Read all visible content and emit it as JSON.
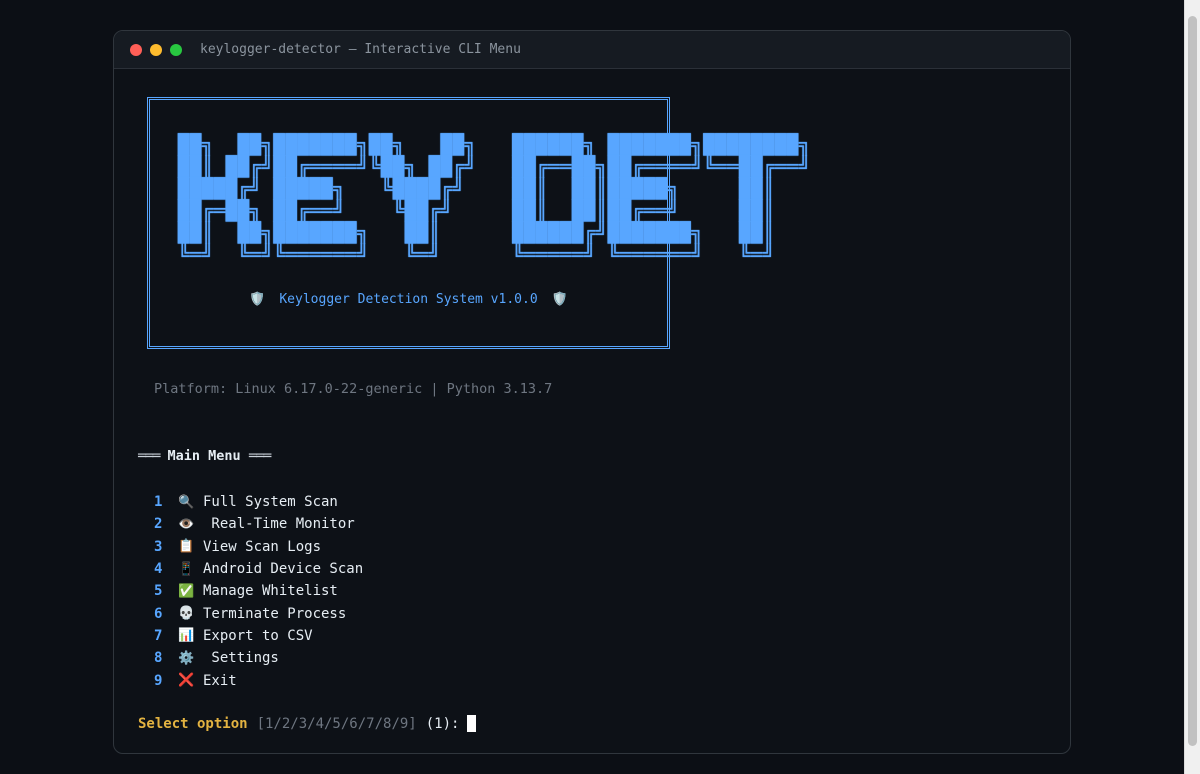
{
  "window": {
    "title": "keylogger-detector — Interactive CLI Menu"
  },
  "banner": {
    "ascii_art": "██╗  ██╗███████╗██╗   ██╗   ██████╗ ███████╗████████╗\n██║ ██╔╝██╔════╝╚██╗ ██╔╝   ██╔══██╗██╔════╝╚══██╔══╝\n█████╔╝ █████╗   ╚████╔╝    ██║  ██║█████╗     ██║   \n██╔═██╗ ██╔══╝    ╚██╔╝     ██║  ██║██╔══╝     ██║   \n██║  ██╗███████╗   ██║      ██████╔╝███████╗   ██║   \n╚═╝  ╚═╝╚══════╝   ╚═╝      ╚═════╝ ╚══════╝   ╚═╝   ",
    "subtitle": "Keylogger Detection System v1.0.0",
    "subtitle_icon": "🛡️"
  },
  "platform_line": "Platform: Linux 6.17.0-22-generic | Python 3.13.7",
  "menu": {
    "heading": "Main Menu",
    "rule_left": "═══",
    "rule_right": "═══",
    "items": [
      {
        "num": "1",
        "icon": "🔍",
        "icon_name": "magnifier-icon",
        "label": "Full System Scan"
      },
      {
        "num": "2",
        "icon": "👁️",
        "icon_name": "eye-icon",
        "label": " Real-Time Monitor"
      },
      {
        "num": "3",
        "icon": "📋",
        "icon_name": "clipboard-icon",
        "label": "View Scan Logs"
      },
      {
        "num": "4",
        "icon": "📱",
        "icon_name": "phone-icon",
        "label": "Android Device Scan"
      },
      {
        "num": "5",
        "icon": "✅",
        "icon_name": "check-icon",
        "label": "Manage Whitelist"
      },
      {
        "num": "6",
        "icon": "💀",
        "icon_name": "skull-icon",
        "label": "Terminate Process"
      },
      {
        "num": "7",
        "icon": "📊",
        "icon_name": "bar-chart-icon",
        "label": "Export to CSV"
      },
      {
        "num": "8",
        "icon": "⚙️",
        "icon_name": "gear-icon",
        "label": " Settings"
      },
      {
        "num": "9",
        "icon": "❌",
        "icon_name": "cross-icon",
        "label": "Exit"
      }
    ]
  },
  "prompt": {
    "label": "Select option",
    "choices": "[1/2/3/4/5/6/7/8/9]",
    "default": "(1):"
  },
  "colors": {
    "accent": "#58a6ff",
    "prompt": "#e3b341",
    "background": "#0d1117"
  }
}
